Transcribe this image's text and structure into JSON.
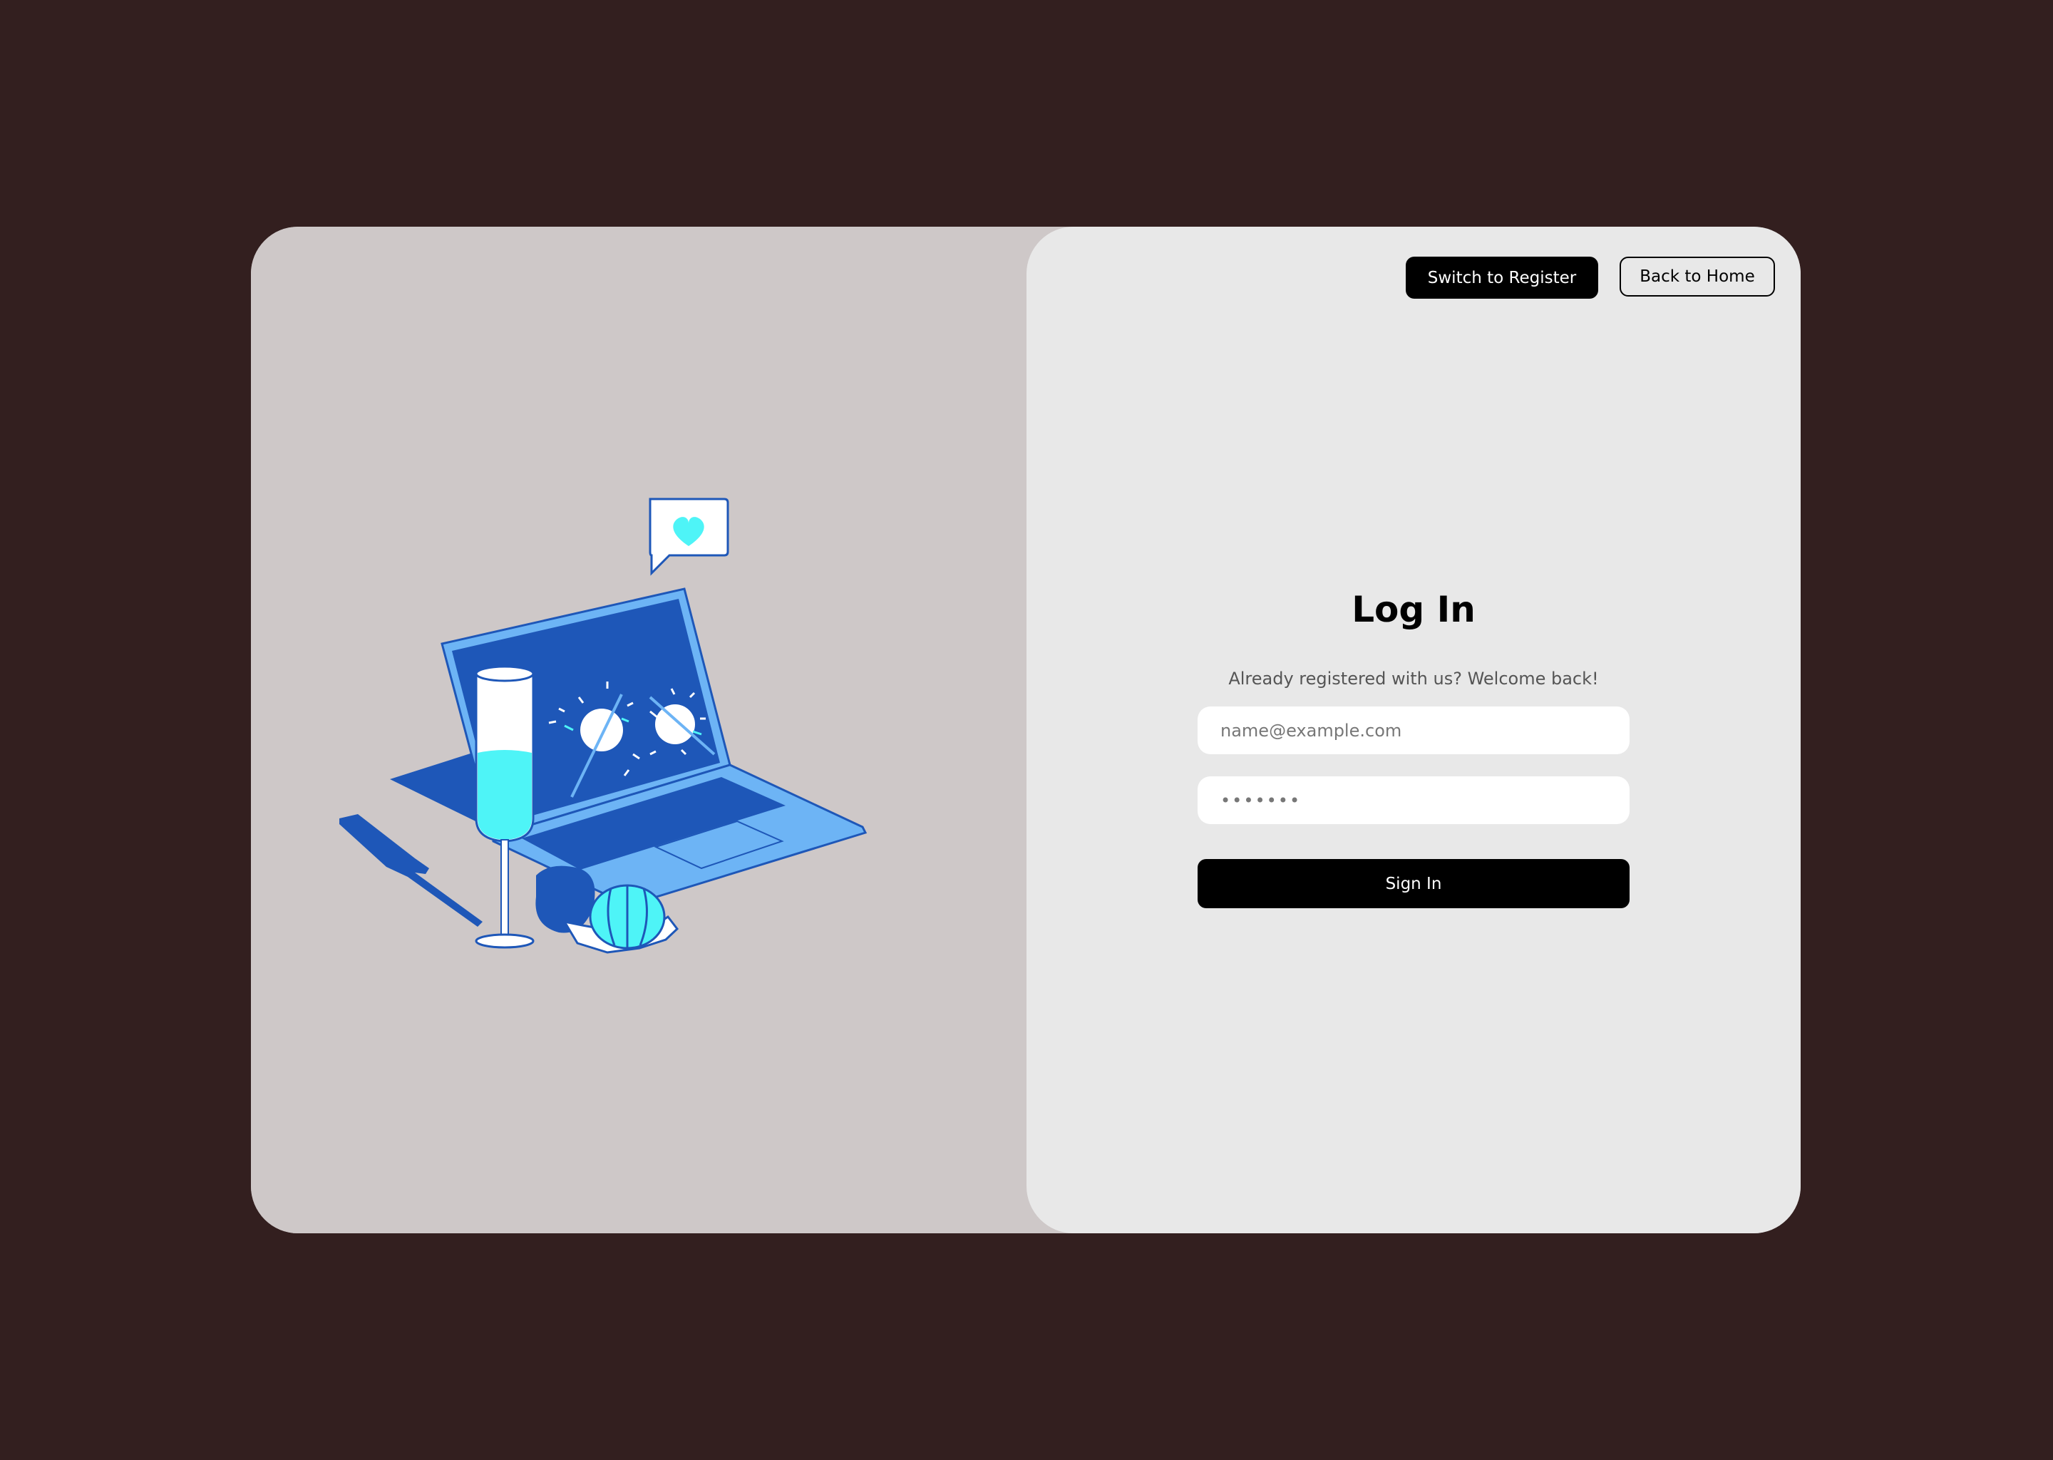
{
  "header": {
    "register_label": "Switch to Register",
    "home_label": "Back to Home"
  },
  "form": {
    "title": "Log In",
    "subtitle": "Already registered with us? Welcome back!",
    "email_placeholder": "name@example.com",
    "password_value": "•••••••",
    "signin_label": "Sign In"
  },
  "colors": {
    "page_background": "#331f1f",
    "left_panel": "#cec8c8",
    "right_panel": "#e8e8e8",
    "illustration_blue": "#1e57b8",
    "illustration_light_blue": "#6db4f5",
    "illustration_cyan": "#4ef4f7"
  },
  "illustration": {
    "icons": [
      "laptop-icon",
      "champagne-glass-icon",
      "heart-speech-bubble-icon",
      "pumpkin-icon",
      "fruit-icon"
    ]
  }
}
